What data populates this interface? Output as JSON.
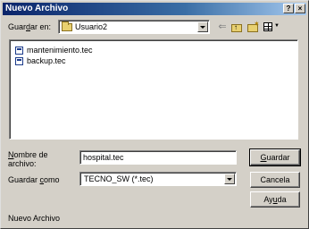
{
  "window": {
    "title": "Nuevo Archivo",
    "help_label": "?",
    "close_label": "×"
  },
  "toolbar": {
    "save_in_label_pre": "Guar",
    "save_in_label_u": "d",
    "save_in_label_post": "ar en:",
    "save_in_value": "Usuario2",
    "back_icon": "back-arrow-icon",
    "up_icon": "up-folder-icon",
    "new_folder_icon": "new-folder-icon",
    "views_icon": "views-menu-icon"
  },
  "files": [
    {
      "name": "mantenimiento.tec"
    },
    {
      "name": "backup.tec"
    }
  ],
  "form": {
    "filename_label_u": "N",
    "filename_label_rest1": "ombre de",
    "filename_label_line2": "archivo:",
    "filename_value": "hospital.tec",
    "filetype_label_pre": "Guardar ",
    "filetype_label_u": "c",
    "filetype_label_post": "omo",
    "filetype_value": "TECNO_SW (*.tec)"
  },
  "buttons": {
    "save_u": "G",
    "save_rest": "uardar",
    "cancel": "Cancela",
    "help_pre": "Ay",
    "help_u": "u",
    "help_post": "da"
  },
  "status": {
    "text": "Nuevo Archivo"
  }
}
